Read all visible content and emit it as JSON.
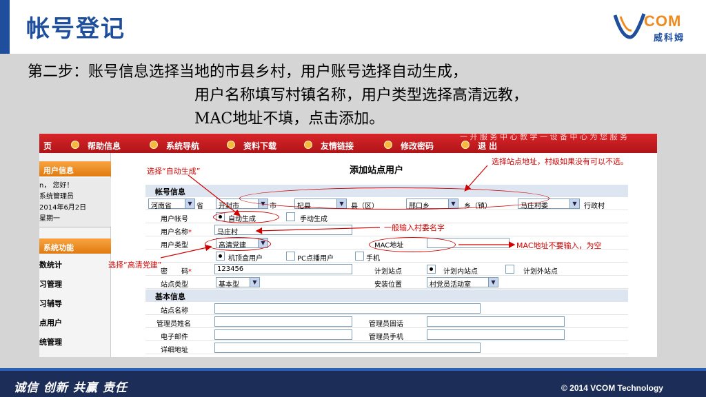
{
  "slide": {
    "title": "帐号登记",
    "step_line1": "第二步：账号信息选择当地的市县乡村，用户账号选择自动生成，",
    "step_line2": "用户名称填写村镇名称，用户类型选择高清远教，",
    "step_line3": "MAC地址不填，点击添加。"
  },
  "logo": {
    "brand": "COM",
    "chinese": "威科姆"
  },
  "nav": {
    "banner": "一 开 服 务 中 心 教 学 一 设 备 中 心 为 您 服 务",
    "items": [
      "页",
      "帮助信息",
      "系统导航",
      "资料下载",
      "友情链接",
      "修改密码",
      "退 出"
    ]
  },
  "sidebar": {
    "user_info_head": "用户信息",
    "greeting": "n， 您好！",
    "role": "系统管理员",
    "date": "2014年6月2日",
    "weekday": "星期一",
    "func_head": "系统功能",
    "items": [
      "数统计",
      "习管理",
      "习辅导",
      "点用户",
      "统管理"
    ]
  },
  "form": {
    "title": "添加站点用户",
    "account_section": "帐号信息",
    "province": "河南省",
    "province_suffix": "省",
    "city": "开封市",
    "city_suffix": "市",
    "county": "杞县",
    "county_suffix": "县（区）",
    "town": "邢口乡",
    "town_suffix": "乡（镇）",
    "village": "马庄村委",
    "village_suffix": "行政村",
    "account_label": "用户帐号",
    "auto_gen": "自动生成",
    "manual_gen": "手动生成",
    "name_label": "用户名称",
    "name_value": "马庄村",
    "type_label": "用户类型",
    "type_value": "高清党建",
    "mac_label": "MAC地址",
    "mac_value": "",
    "user_kind_1": "机顶盒用户",
    "user_kind_2": "PC点播用户",
    "user_kind_3": "手机",
    "password_label": "密　　码",
    "password_value": "123456",
    "plan_label": "计划站点",
    "plan_in": "计划内站点",
    "plan_out": "计划外站点",
    "site_type_label": "站点类型",
    "site_type_value": "基本型",
    "install_label": "安装位置",
    "install_value": "村党员活动室",
    "basic_section": "基本信息",
    "site_name_label": "站点名称",
    "admin_name_label": "管理员姓名",
    "admin_phone_label": "管理员固话",
    "email_label": "电子邮件",
    "admin_mobile_label": "管理员手机",
    "address_label": "详细地址",
    "required_mark": "*"
  },
  "annotations": {
    "auto": "选择“自动生成”",
    "station": "选择站点地址，村级如果没有可以不选。",
    "name": "一般输入村委名字",
    "mac": "MAC地址不要输入，为空",
    "hd": "选择“高清党建”"
  },
  "footer": {
    "slogan": "诚信 创新 共赢 责任",
    "copyright": "© 2014 VCOM Technology"
  },
  "colors": {
    "title_blue": "#1f4e9c",
    "nav_red": "#c41e22",
    "annotation_red": "#d00000",
    "footer_navy": "#1c2d57"
  }
}
